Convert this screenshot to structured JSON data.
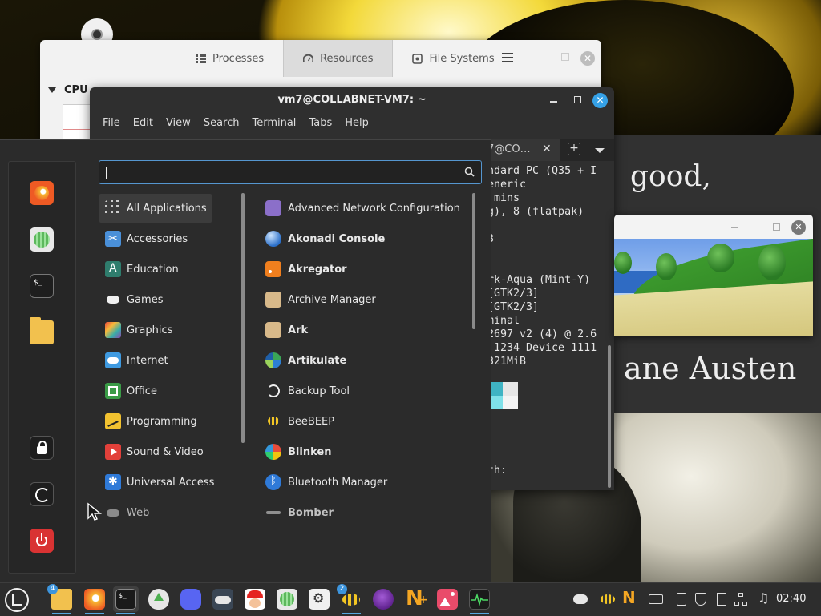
{
  "system_monitor": {
    "tabs": [
      {
        "label": "Processes"
      },
      {
        "label": "Resources"
      },
      {
        "label": "File Systems"
      }
    ],
    "section": "CPU"
  },
  "terminal": {
    "title": "vm7@COLLABNET-VM7: ~",
    "menu": [
      "File",
      "Edit",
      "View",
      "Search",
      "Terminal",
      "Tabs",
      "Help"
    ],
    "tab_label": "7@CO…",
    "output_lines": [
      "ndard PC (Q35 + I",
      "eneric",
      " mins",
      "g), 8 (flatpak)",
      "",
      "3",
      "",
      "",
      "rk-Aqua (Mint-Y)",
      "[GTK2/3]",
      "[GTK2/3]",
      "minal",
      "2697 v2 (4) @ 2.6",
      " 1234 Device 1111",
      "321MiB",
      "",
      "",
      "",
      "",
      "",
      "",
      "",
      "th:"
    ]
  },
  "browser_page": {
    "text_good": "good,",
    "text_author": "ane Austen"
  },
  "app_menu": {
    "search": {
      "value": "",
      "placeholder": ""
    },
    "categories": [
      {
        "label": "All Applications",
        "icon": "grid-icon",
        "selected": true
      },
      {
        "label": "Accessories",
        "icon": "accessories-icon"
      },
      {
        "label": "Education",
        "icon": "education-icon"
      },
      {
        "label": "Games",
        "icon": "games-icon"
      },
      {
        "label": "Graphics",
        "icon": "graphics-icon"
      },
      {
        "label": "Internet",
        "icon": "internet-icon"
      },
      {
        "label": "Office",
        "icon": "office-icon"
      },
      {
        "label": "Programming",
        "icon": "programming-icon"
      },
      {
        "label": "Sound & Video",
        "icon": "sound-video-icon"
      },
      {
        "label": "Universal Access",
        "icon": "universal-access-icon"
      },
      {
        "label": "Web",
        "icon": "web-icon"
      }
    ],
    "apps": [
      {
        "label": "Advanced Network Configuration",
        "bold": false
      },
      {
        "label": "Akonadi Console",
        "bold": true
      },
      {
        "label": "Akregator",
        "bold": true
      },
      {
        "label": "Archive Manager",
        "bold": false
      },
      {
        "label": "Ark",
        "bold": true
      },
      {
        "label": "Artikulate",
        "bold": true
      },
      {
        "label": "Backup Tool",
        "bold": false
      },
      {
        "label": "BeeBEEP",
        "bold": false
      },
      {
        "label": "Blinken",
        "bold": true
      },
      {
        "label": "Bluetooth Manager",
        "bold": false
      },
      {
        "label": "Bomber",
        "bold": true
      }
    ]
  },
  "taskbar": {
    "files_badge": "4",
    "beebeep_badge": "2",
    "clock": "02:40"
  },
  "colors": {
    "accent": "#3d95dd",
    "terminal_close": "#35a1e7",
    "menu_bg": "#2b2b2b"
  }
}
